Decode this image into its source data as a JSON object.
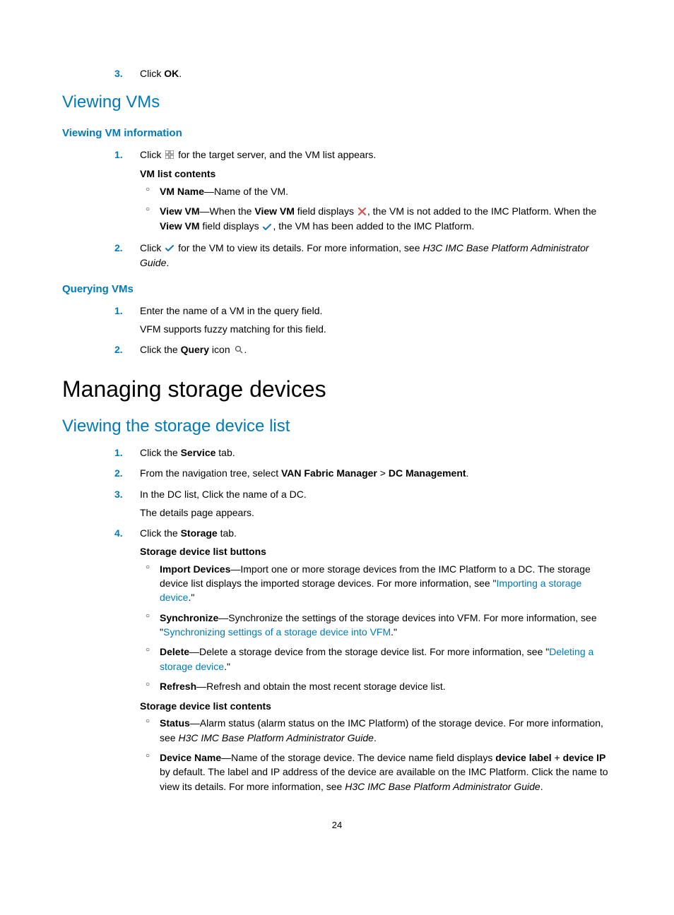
{
  "step3": {
    "num": "3.",
    "pre": "Click ",
    "bold": "OK",
    "post": "."
  },
  "h2_viewing_vms": "Viewing VMs",
  "h3_view_vm_info": "Viewing VM information",
  "vv_step1_num": "1.",
  "vv_step1_pre": "Click ",
  "vv_step1_post": " for the target server, and the VM list appears.",
  "vv_step1_sub_b": "VM list contents",
  "vv_b_vmname": "VM Name",
  "vv_b_vmname_post": "—Name of the VM.",
  "vv_b_viewvm": "View VM",
  "vv_b_viewvm_t1_a": "—When the ",
  "vv_b_viewvm_t1_b": "View VM",
  "vv_b_viewvm_t1_c": " field displays ",
  "vv_b_viewvm_t1_d": ", the VM is not added to the IMC Platform. When the ",
  "vv_b_viewvm_t1_e": "View VM",
  "vv_b_viewvm_t1_f": " field displays ",
  "vv_b_viewvm_t1_g": ", the VM has been added to the IMC Platform.",
  "vv_step2_num": "2.",
  "vv_step2_pre": "Click ",
  "vv_step2_post": " for the VM to view its details. For more information, see ",
  "vv_step2_i": "H3C IMC Base Platform Administrator Guide",
  "vv_step2_end": ".",
  "h3_querying_vms": "Querying VMs",
  "qv_step1_num": "1.",
  "qv_step1": "Enter the name of a VM in the query field.",
  "qv_step1_sub": "VFM supports fuzzy matching for this field.",
  "qv_step2_num": "2.",
  "qv_step2_pre": "Click the ",
  "qv_step2_b": "Query",
  "qv_step2_mid": " icon ",
  "qv_step2_end": ".",
  "h1_managing": "Managing storage devices",
  "h2_view_storage": "Viewing the storage device list",
  "sd_step1_num": "1.",
  "sd_step1_pre": "Click the ",
  "sd_step1_b": "Service",
  "sd_step1_post": " tab.",
  "sd_step2_num": "2.",
  "sd_step2_pre": "From the navigation tree, select ",
  "sd_step2_b1": "VAN Fabric Manager",
  "sd_step2_sep": " > ",
  "sd_step2_b2": "DC Management",
  "sd_step2_end": ".",
  "sd_step3_num": "3.",
  "sd_step3": "In the DC list, Click the name of a DC.",
  "sd_step3_sub": "The details page appears.",
  "sd_step4_num": "4.",
  "sd_step4_pre": "Click the ",
  "sd_step4_b": "Storage",
  "sd_step4_post": " tab.",
  "sd_step4_sub_b": "Storage device list buttons",
  "sd_import_b": "Import Devices",
  "sd_import_t1": "—Import one or more storage devices from the IMC Platform to a DC. The storage device list displays the imported storage devices. For more information, see \"",
  "sd_import_link": "Importing a storage device",
  "sd_import_t2": ".\"",
  "sd_sync_b": "Synchronize",
  "sd_sync_t1": "—Synchronize the settings of the storage devices into VFM. For more information, see \"",
  "sd_sync_link": "Synchronizing settings of a storage device into VFM",
  "sd_sync_t2": ".\"",
  "sd_del_b": "Delete",
  "sd_del_t1": "—Delete a storage device from the storage device list. For more information, see \"",
  "sd_del_link": "Deleting a storage device",
  "sd_del_t2": ".\"",
  "sd_ref_b": "Refresh",
  "sd_ref_t1": "—Refresh and obtain the most recent storage device list.",
  "sd_contents_b": "Storage device list contents",
  "sd_status_b": "Status",
  "sd_status_t1": "—Alarm status (alarm status on the IMC Platform) of the storage device. For more information, see ",
  "sd_status_i": "H3C IMC Base Platform Administrator Guide",
  "sd_status_t2": ".",
  "sd_dev_b": "Device Name",
  "sd_dev_t1": "—Name of the storage device. The device name field displays ",
  "sd_dev_b2": "device label",
  "sd_dev_plus": " + ",
  "sd_dev_b3": "device IP",
  "sd_dev_t2": " by default. The label and IP address of the device are available on the IMC Platform. Click the name to view its details. For more information, see ",
  "sd_dev_i": "H3C IMC Base Platform Administrator Guide",
  "sd_dev_t3": ".",
  "page_number": "24"
}
